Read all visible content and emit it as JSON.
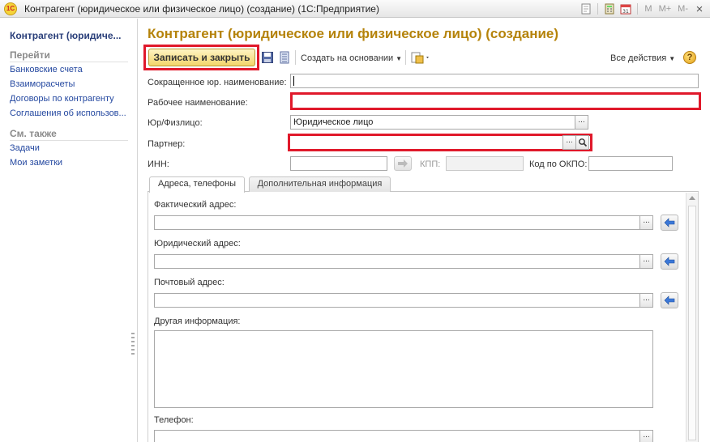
{
  "window": {
    "title": "Контрагент (юридическое или физическое лицо) (создание)  (1С:Предприятие)",
    "app_logo": "1С",
    "memory_buttons": [
      "M",
      "M+",
      "M-"
    ],
    "close": "×"
  },
  "left_panel": {
    "title": "Контрагент (юридиче...",
    "goto_header": "Перейти",
    "goto_items": [
      "Банковские счета",
      "Взаиморасчеты",
      "Договоры по контрагенту",
      "Соглашения об использов..."
    ],
    "see_also_header": "См. также",
    "see_also_items": [
      "Задачи",
      "Мои заметки"
    ]
  },
  "form": {
    "title": "Контрагент (юридическое или физическое лицо) (создание)",
    "toolbar": {
      "save_close": "Записать и закрыть",
      "create_based": "Создать на основании",
      "all_actions": "Все действия",
      "help": "?"
    },
    "fields": {
      "short_name_label": "Сокращенное юр. наименование:",
      "short_name_value": "",
      "work_name_label": "Рабочее наименование:",
      "work_name_value": "",
      "type_label": "Юр/Физлицо:",
      "type_value": "Юридическое лицо",
      "partner_label": "Партнер:",
      "partner_value": "",
      "inn_label": "ИНН:",
      "inn_value": "",
      "kpp_label": "КПП:",
      "kpp_value": "",
      "okpo_label": "Код по ОКПО:",
      "okpo_value": ""
    },
    "tabs": [
      "Адреса, телефоны",
      "Дополнительная информация"
    ],
    "addresses": {
      "actual_label": "Фактический адрес:",
      "legal_label": "Юридический адрес:",
      "postal_label": "Почтовый адрес:",
      "other_label": "Другая информация:",
      "phone_label": "Телефон:"
    },
    "select_glyph": "...",
    "colors": {
      "title": "#b5830a",
      "link": "#2448a0",
      "required": "#e0192b",
      "save_button": "#f2d56a"
    }
  }
}
